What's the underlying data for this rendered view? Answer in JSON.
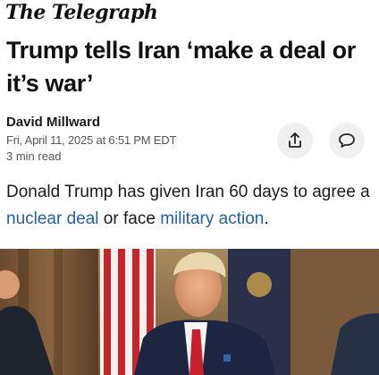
{
  "masthead": {
    "title": "The Telegraph"
  },
  "article": {
    "headline": "Trump tells Iran ‘make a deal or it’s war’",
    "author": "David Millward",
    "dateline": "Fri, April 11, 2025 at 6:51 PM EDT",
    "read_time": "3 min read",
    "summary": {
      "part1": "Donald Trump has given Iran 60 days to agree a ",
      "link1": "nuclear deal",
      "part2": " or face ",
      "link2": "military action",
      "part3": "."
    }
  },
  "actions": {
    "share_icon": "share-icon",
    "comment_icon": "comment-icon"
  },
  "hero_image": {
    "icon": "photo-image"
  },
  "colors": {
    "link": "#1f5fae",
    "button_bg": "#f0f0f0"
  }
}
